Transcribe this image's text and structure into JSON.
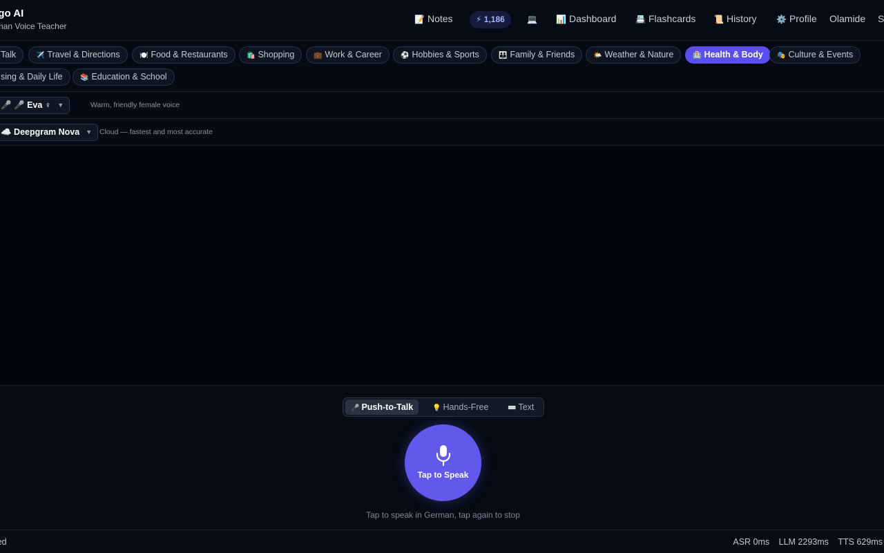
{
  "brand": {
    "title": "ingo AI",
    "subtitle": "erman Voice Teacher"
  },
  "nav": {
    "notes": "Notes",
    "notes_icon": "📝",
    "xp_icon": "⚡",
    "xp": "1,186",
    "screen_icon": "💻",
    "dashboard": "Dashboard",
    "dashboard_icon": "📊",
    "flashcards": "Flashcards",
    "flashcards_icon": "📇",
    "history": "History",
    "history_icon": "📜",
    "profile": "Profile",
    "profile_icon": "⚙️",
    "user": "Olamide",
    "overflow": "S"
  },
  "topics": [
    {
      "icon": "",
      "label": "Talk"
    },
    {
      "icon": "✈️",
      "label": "Travel & Directions"
    },
    {
      "icon": "🍽️",
      "label": "Food & Restaurants"
    },
    {
      "icon": "🛍️",
      "label": "Shopping"
    },
    {
      "icon": "💼",
      "label": "Work & Career"
    },
    {
      "icon": "⚽",
      "label": "Hobbies & Sports"
    },
    {
      "icon": "👪",
      "label": "Family & Friends"
    },
    {
      "icon": "🌤️",
      "label": "Weather & Nature"
    },
    {
      "icon": "🏥",
      "label": "Health & Body"
    },
    {
      "icon": "🎭",
      "label": "Culture & Events"
    },
    {
      "icon": "",
      "label": "sing & Daily Life"
    },
    {
      "icon": "📚",
      "label": "Education & School"
    }
  ],
  "active_topic": "Health & Body",
  "voice": {
    "value": "🎤 🎤 Eva ♀",
    "hint": "Warm, friendly female voice"
  },
  "asr": {
    "value": "☁️ Deepgram Nova",
    "hint": "Cloud — fastest and most accurate"
  },
  "modes": [
    {
      "icon": "🎤",
      "label": "Push-to-Talk"
    },
    {
      "icon": "💡",
      "label": "Hands-Free"
    },
    {
      "icon": "⌨️",
      "label": "Text"
    }
  ],
  "speak": {
    "label": "Tap to Speak",
    "hint": "Tap to speak in German, tap again to stop"
  },
  "status": {
    "connection": "cted",
    "asr": "ASR 0ms",
    "llm": "LLM 2293ms",
    "tts": "TTS 629ms"
  },
  "colors": {
    "accent": "#5b4ef0",
    "speak_button": "#6159ec",
    "background": "#050a14"
  }
}
